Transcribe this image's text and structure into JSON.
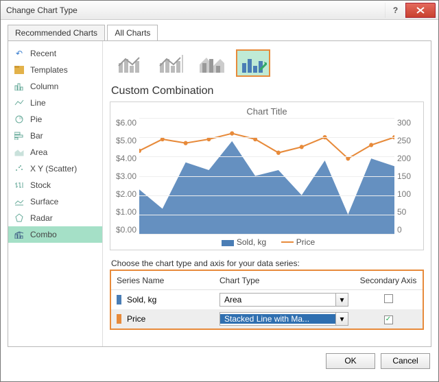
{
  "window": {
    "title": "Change Chart Type"
  },
  "tabs": {
    "recommended": "Recommended Charts",
    "all": "All Charts"
  },
  "sidebar": {
    "items": [
      {
        "label": "Recent"
      },
      {
        "label": "Templates"
      },
      {
        "label": "Column"
      },
      {
        "label": "Line"
      },
      {
        "label": "Pie"
      },
      {
        "label": "Bar"
      },
      {
        "label": "Area"
      },
      {
        "label": "X Y (Scatter)"
      },
      {
        "label": "Stock"
      },
      {
        "label": "Surface"
      },
      {
        "label": "Radar"
      },
      {
        "label": "Combo"
      }
    ]
  },
  "section_title": "Custom Combination",
  "chart_title": "Chart Title",
  "chooser_label": "Choose the chart type and axis for your data series:",
  "series_grid": {
    "headers": {
      "name": "Series Name",
      "type": "Chart Type",
      "axis": "Secondary Axis"
    },
    "rows": [
      {
        "name": "Sold, kg",
        "swatch": "#4a7db5",
        "type": "Area",
        "secondary": false,
        "selected": false
      },
      {
        "name": "Price",
        "swatch": "#e78a3a",
        "type": "Stacked Line with Ma...",
        "secondary": true,
        "selected": true
      }
    ]
  },
  "legend": {
    "sold": "Sold, kg",
    "price": "Price"
  },
  "buttons": {
    "ok": "OK",
    "cancel": "Cancel"
  },
  "chart_data": {
    "type": "combo",
    "title": "Chart Title",
    "x_count": 12,
    "y_left": {
      "label": "",
      "min": 0,
      "max": 6,
      "step": 1,
      "format": "$0.00"
    },
    "y_right": {
      "label": "",
      "min": 0,
      "max": 300,
      "step": 50
    },
    "series": [
      {
        "name": "Sold, kg",
        "type": "area",
        "axis": "left",
        "color": "#4a7db5",
        "values": [
          2.3,
          1.3,
          3.7,
          3.3,
          4.8,
          3.0,
          3.3,
          2.0,
          3.8,
          1.0,
          3.9,
          3.5
        ]
      },
      {
        "name": "Price",
        "type": "line_marker",
        "axis": "right",
        "color": "#e78a3a",
        "values": [
          215,
          245,
          235,
          245,
          260,
          245,
          210,
          225,
          250,
          195,
          230,
          250
        ]
      }
    ]
  }
}
